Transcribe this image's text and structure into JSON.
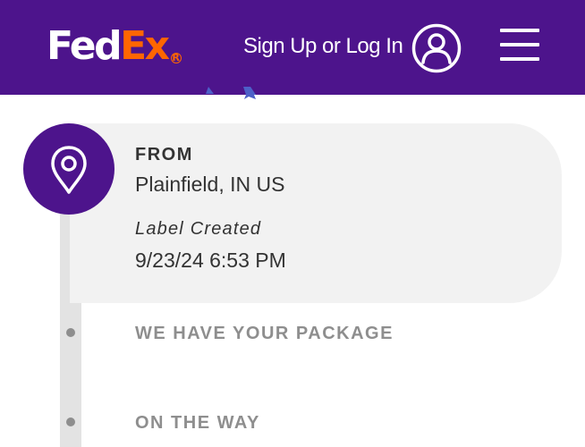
{
  "header": {
    "logo_fed": "Fed",
    "logo_ex": "Ex",
    "logo_mark": "R",
    "signin_label": "Sign Up or Log In",
    "account_icon": "account-icon",
    "menu_icon": "hamburger-menu-icon"
  },
  "origin": {
    "from_label": "FROM",
    "location": "Plainfield, IN US",
    "status": "Label Created",
    "datetime": "9/23/24 6:53 PM",
    "icon": "location-pin-icon"
  },
  "milestones": [
    {
      "label": "WE HAVE YOUR PACKAGE"
    },
    {
      "label": "ON THE WAY"
    }
  ],
  "colors": {
    "brand_purple": "#4d148c",
    "brand_orange": "#ff6600",
    "card_bg": "#f2f2f2",
    "muted_text": "#8e8e8e",
    "track": "#e3e3e3"
  }
}
